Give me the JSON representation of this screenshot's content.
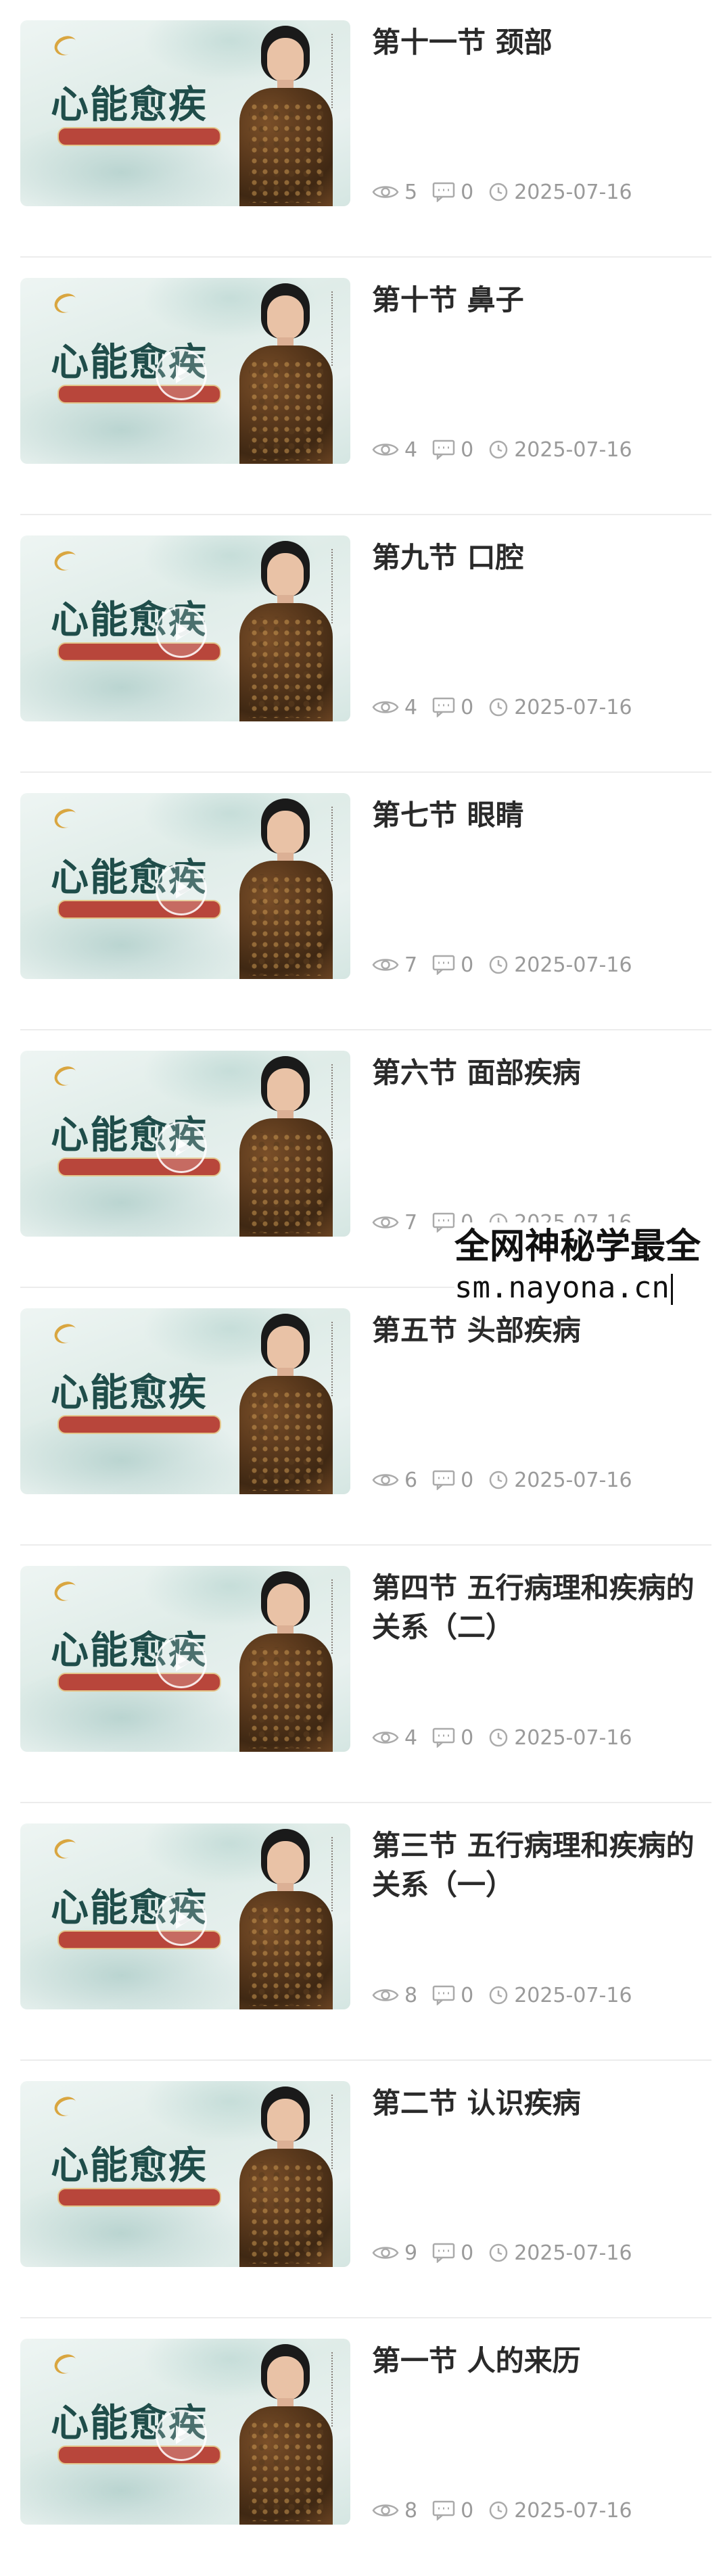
{
  "lessons": [
    {
      "title": "第十一节 颈部",
      "views": "5",
      "comments": "0",
      "date": "2025-07-16",
      "thumb_title": "心能愈疾",
      "has_play": false
    },
    {
      "title": "第十节 鼻子",
      "views": "4",
      "comments": "0",
      "date": "2025-07-16",
      "thumb_title": "心能愈疾",
      "has_play": true
    },
    {
      "title": "第九节 口腔",
      "views": "4",
      "comments": "0",
      "date": "2025-07-16",
      "thumb_title": "心能愈疾",
      "has_play": true
    },
    {
      "title": "第七节 眼睛",
      "views": "7",
      "comments": "0",
      "date": "2025-07-16",
      "thumb_title": "心能愈疾",
      "has_play": true
    },
    {
      "title": "第六节 面部疾病",
      "views": "7",
      "comments": "0",
      "date": "2025-07-16",
      "thumb_title": "心能愈疾",
      "has_play": true
    },
    {
      "title": "第五节 头部疾病",
      "views": "6",
      "comments": "0",
      "date": "2025-07-16",
      "thumb_title": "心能愈疾",
      "has_play": false
    },
    {
      "title": "第四节 五行病理和疾病的关系（二）",
      "views": "4",
      "comments": "0",
      "date": "2025-07-16",
      "thumb_title": "心能愈疾",
      "has_play": true
    },
    {
      "title": "第三节 五行病理和疾病的关系（一）",
      "views": "8",
      "comments": "0",
      "date": "2025-07-16",
      "thumb_title": "心能愈疾",
      "has_play": true
    },
    {
      "title": "第二节 认识疾病",
      "views": "9",
      "comments": "0",
      "date": "2025-07-16",
      "thumb_title": "心能愈疾",
      "has_play": false
    },
    {
      "title": "第一节 人的来历",
      "views": "8",
      "comments": "0",
      "date": "2025-07-16",
      "thumb_title": "心能愈疾",
      "has_play": true
    }
  ],
  "watermark": {
    "line1": "全网神秘学最全",
    "line2": "sm.nayona.cn"
  }
}
